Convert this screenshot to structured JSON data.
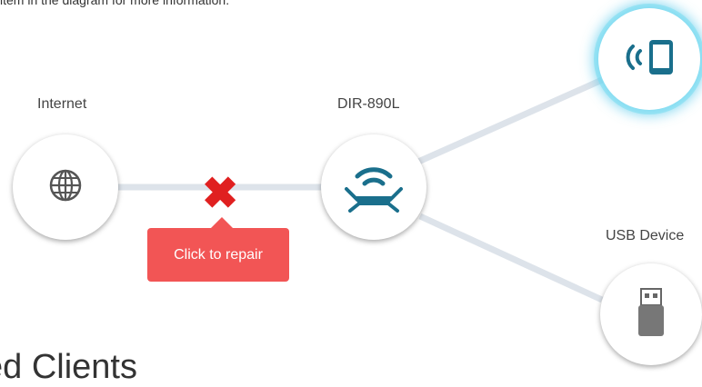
{
  "instruction_text": "item in the diagram for more information.",
  "nodes": {
    "internet": {
      "label": "Internet",
      "icon": "globe-icon"
    },
    "router": {
      "label": "DIR-890L",
      "icon": "router-icon"
    },
    "wireless_client": {
      "icon": "tablet-wireless-icon"
    },
    "usb": {
      "label": "USB Device",
      "icon": "usb-drive-icon"
    }
  },
  "error": {
    "icon": "x-icon",
    "symbol": "✖",
    "color": "#e02020",
    "repair_label": "Click to repair"
  },
  "section_heading": "ed Clients",
  "colors": {
    "accent": "#1a6f8c",
    "link_line": "#dde3ea",
    "error_button": "#f25555",
    "selected_glow": "#50c8eb"
  }
}
